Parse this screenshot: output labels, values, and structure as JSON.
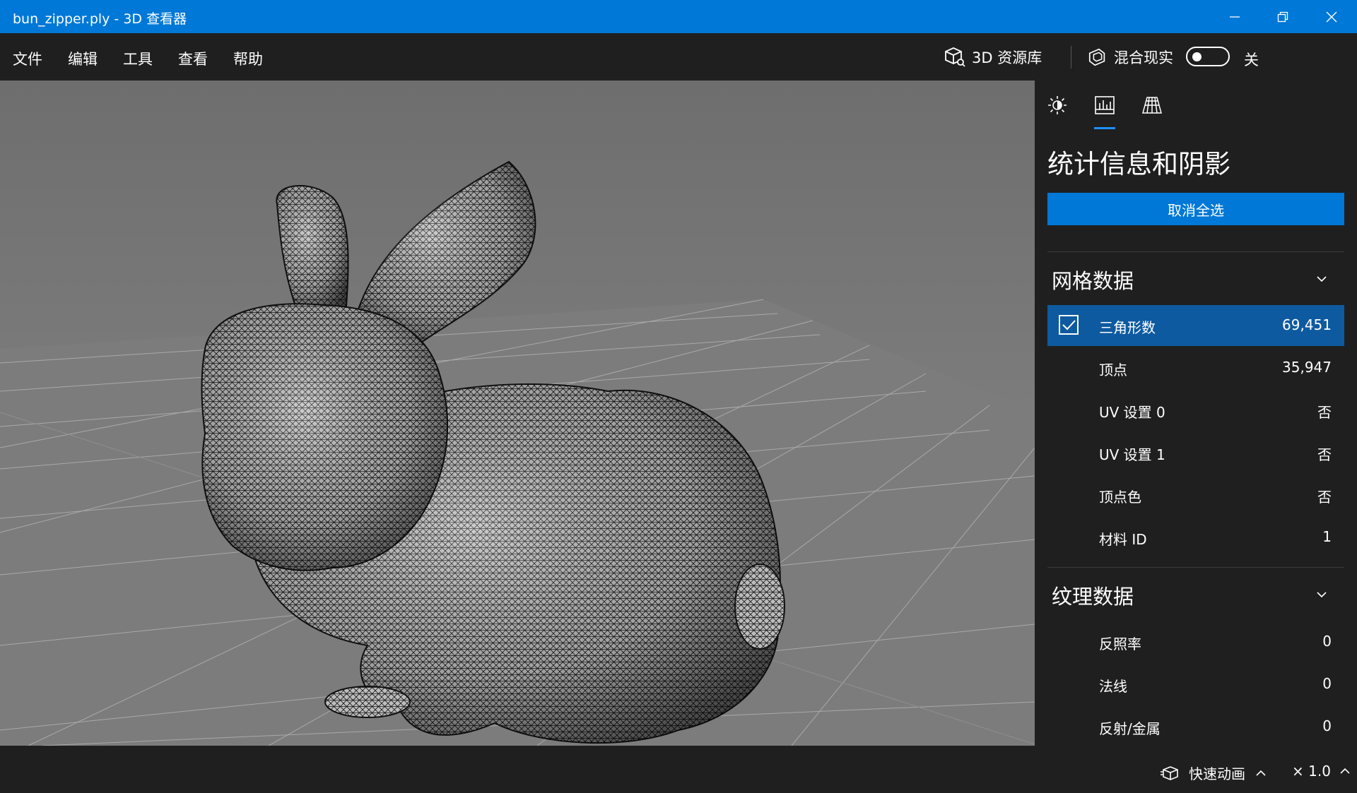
{
  "window": {
    "title": "bun_zipper.ply - 3D 查看器",
    "accent": "#0078d7"
  },
  "menu": {
    "items": [
      "文件",
      "编辑",
      "工具",
      "查看",
      "帮助"
    ]
  },
  "toolbar": {
    "library_label": "3D 资源库",
    "mixed_reality_label": "混合现实",
    "toggle_state": "关"
  },
  "panel": {
    "tabs": [
      "lighting-icon",
      "stats-icon",
      "grid-icon"
    ],
    "active_tab": "stats-icon",
    "title": "统计信息和阴影",
    "deselect_button": "取消全选",
    "mesh_section": {
      "title": "网格数据",
      "rows": [
        {
          "label": "三角形数",
          "value": "69,451",
          "checked": true
        },
        {
          "label": "顶点",
          "value": "35,947"
        },
        {
          "label": "UV 设置 0",
          "value": "否"
        },
        {
          "label": "UV 设置 1",
          "value": "否"
        },
        {
          "label": "顶点色",
          "value": "否"
        },
        {
          "label": "材料 ID",
          "value": "1"
        }
      ]
    },
    "texture_section": {
      "title": "纹理数据",
      "rows": [
        {
          "label": "反照率",
          "value": "0"
        },
        {
          "label": "法线",
          "value": "0"
        },
        {
          "label": "反射/金属",
          "value": "0"
        }
      ]
    }
  },
  "status": {
    "quick_animation": "快速动画",
    "speed": "× 1.0"
  }
}
